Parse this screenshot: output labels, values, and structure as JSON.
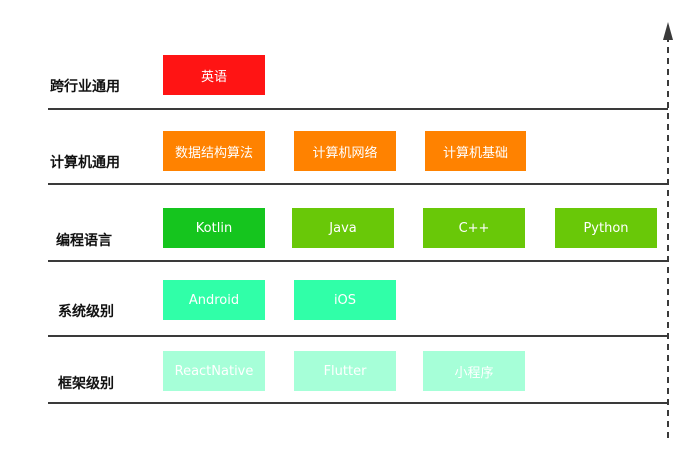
{
  "rows": [
    {
      "label": "跨行业通用",
      "color": "#ff1414",
      "items": [
        "英语"
      ]
    },
    {
      "label": "计算机通用",
      "color": "#ff8200",
      "items": [
        "数据结构算法",
        "计算机网络",
        "计算机基础"
      ]
    },
    {
      "label": "编程语言",
      "color_first": "#15c51e",
      "color": "#69c808",
      "items": [
        "Kotlin",
        "Java",
        "C++",
        "Python"
      ]
    },
    {
      "label": "系统级别",
      "color": "#30ffa8",
      "items": [
        "Android",
        "iOS"
      ]
    },
    {
      "label": "框架级别",
      "color": "#a6ffd8",
      "items": [
        "ReactNative",
        "Flutter",
        "小程序"
      ]
    }
  ],
  "colors": {
    "line": "#3a3a3a",
    "label_text": "#111111",
    "box_text": "#ffffff"
  },
  "icons": {
    "axis": "dashed-up-arrow-icon"
  }
}
